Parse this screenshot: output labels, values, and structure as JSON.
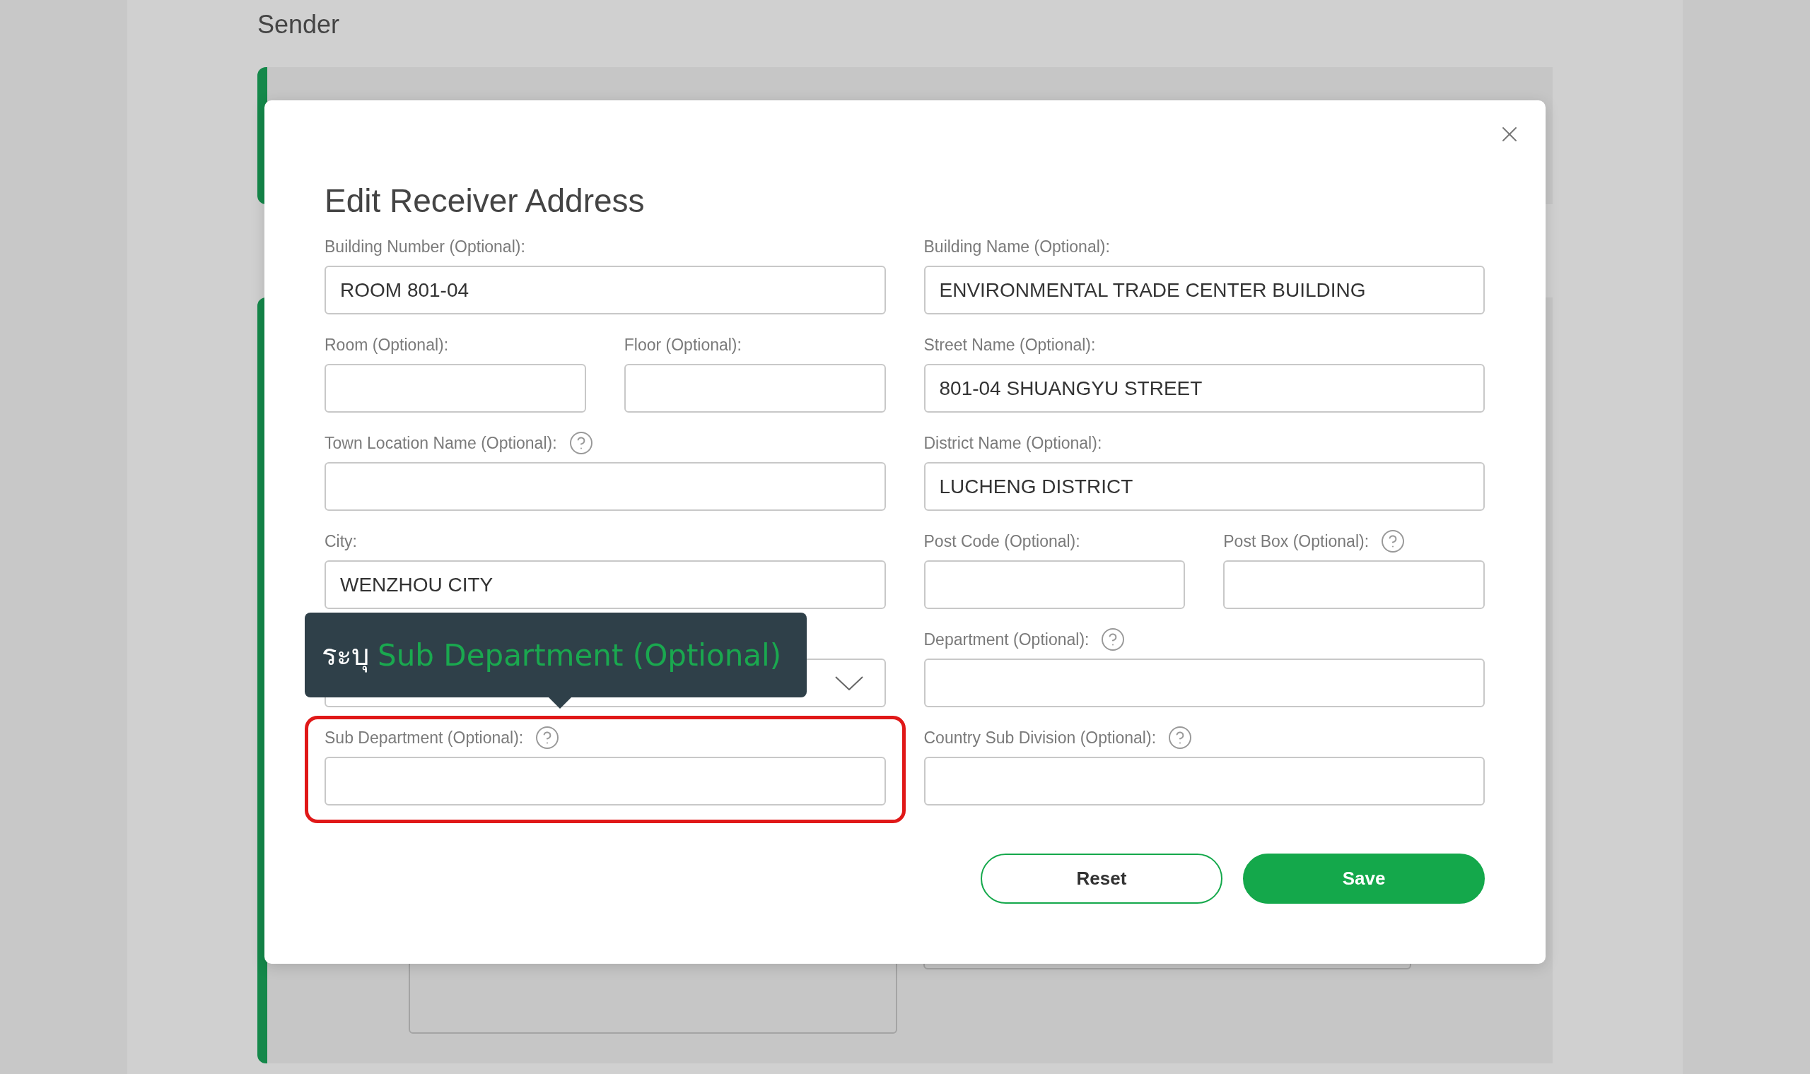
{
  "background": {
    "heading": "Sender",
    "cards": [
      {
        "kind": "short"
      },
      {
        "kind": "tall"
      }
    ]
  },
  "dialog": {
    "title": "Edit Receiver Address",
    "rows": [
      [
        [
          {
            "kind": "text",
            "label": "Building Number (Optional):",
            "value": "ROOM 801-04"
          }
        ],
        [
          {
            "kind": "text",
            "label": "Building Name (Optional):",
            "value": "ENVIRONMENTAL TRADE CENTER BUILDING"
          }
        ]
      ],
      [
        [
          {
            "kind": "text",
            "label": "Room (Optional):"
          },
          {
            "kind": "text",
            "label": "Floor (Optional):"
          }
        ],
        [
          {
            "kind": "text",
            "label": "Street Name (Optional):",
            "value": "801-04 SHUANGYU STREET"
          }
        ]
      ],
      [
        [
          {
            "kind": "text",
            "label": "Town Location Name (Optional):",
            "help": true
          }
        ],
        [
          {
            "kind": "text",
            "label": "District Name (Optional):",
            "value": "LUCHENG DISTRICT"
          }
        ]
      ],
      [
        [
          {
            "kind": "text",
            "label": "City:",
            "value": "WENZHOU CITY"
          }
        ],
        [
          {
            "kind": "text",
            "label": "Post Code (Optional):"
          },
          {
            "kind": "text",
            "label": "Post Box (Optional):",
            "help": true
          }
        ]
      ],
      [
        [
          {
            "kind": "select"
          }
        ],
        [
          {
            "kind": "text",
            "label": "Department (Optional):",
            "help": true
          }
        ]
      ],
      [
        [
          {
            "kind": "text",
            "label": "Sub Department (Optional):",
            "help": true,
            "highlighted": true
          }
        ],
        [
          {
            "kind": "text",
            "label": "Country Sub Division (Optional):",
            "help": true
          }
        ]
      ]
    ],
    "tooltip": {
      "prefix": "ระบุ",
      "text": "Sub Department (Optional)"
    },
    "buttons": [
      {
        "kind": "secondary",
        "label": "Reset"
      },
      {
        "kind": "primary",
        "label": "Save"
      }
    ]
  }
}
